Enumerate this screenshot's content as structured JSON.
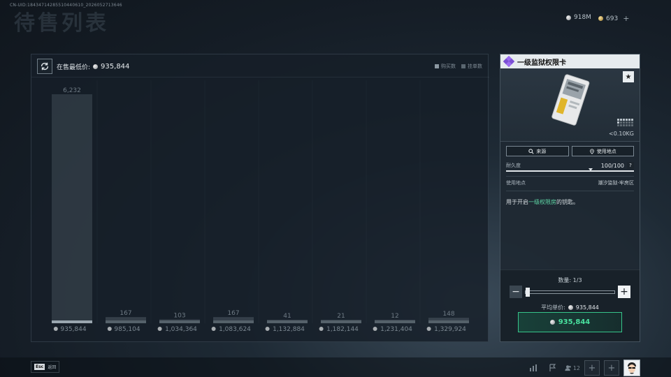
{
  "header": {
    "uid_text": "CN-UID:18434714285510440610_2026052713646",
    "page_title": "待售列表",
    "currencies": [
      {
        "icon": "silver-coin-icon",
        "value": "918M"
      },
      {
        "icon": "gold-coin-icon",
        "value": "693"
      }
    ]
  },
  "chart_panel": {
    "lowest_label": "在售最低价:",
    "lowest_value": "935,844",
    "legend": [
      {
        "label": "购买数",
        "color": "#8c98a2"
      },
      {
        "label": "挂单数",
        "color": "#5a6670"
      }
    ]
  },
  "chart_data": {
    "type": "bar",
    "categories": [
      "935,844",
      "985,104",
      "1,034,364",
      "1,083,624",
      "1,132,884",
      "1,182,144",
      "1,231,404",
      "1,329,924"
    ],
    "values": [
      6232,
      167,
      103,
      167,
      41,
      21,
      12,
      148
    ],
    "value_labels": [
      "6,232",
      "167",
      "103",
      "167",
      "41",
      "21",
      "12",
      "148"
    ],
    "title": "",
    "xlabel": "",
    "ylabel": "",
    "ylim": [
      0,
      6232
    ],
    "grid": false,
    "legend_placement": "top-right"
  },
  "item": {
    "name": "一级监狱权限卡",
    "weight": "<0.10KG",
    "source_label": "来源",
    "use_location_button": "使用地点",
    "durability_label": "耐久度",
    "durability_value": "100/100",
    "durability_fraction": 1.0,
    "help_label": "?",
    "location_label": "使用地点",
    "location_value": "潮汐监狱-牢房区",
    "desc_prefix": "用于开启",
    "desc_highlight": "一级权限房",
    "desc_suffix": "的钥匙。",
    "star": "★",
    "accent_color": "#5fd6a6"
  },
  "purchase": {
    "quantity_label": "数量: 1/3",
    "minus": "−",
    "plus": "+",
    "avg_label": "平均单价:",
    "avg_value": "935,844",
    "buy_value": "935,844",
    "buy_color": "#49e19f"
  },
  "footer": {
    "esc_key": "Esc",
    "back_label": "返回",
    "friends_count": "12",
    "add1": "+",
    "add2": "+"
  }
}
